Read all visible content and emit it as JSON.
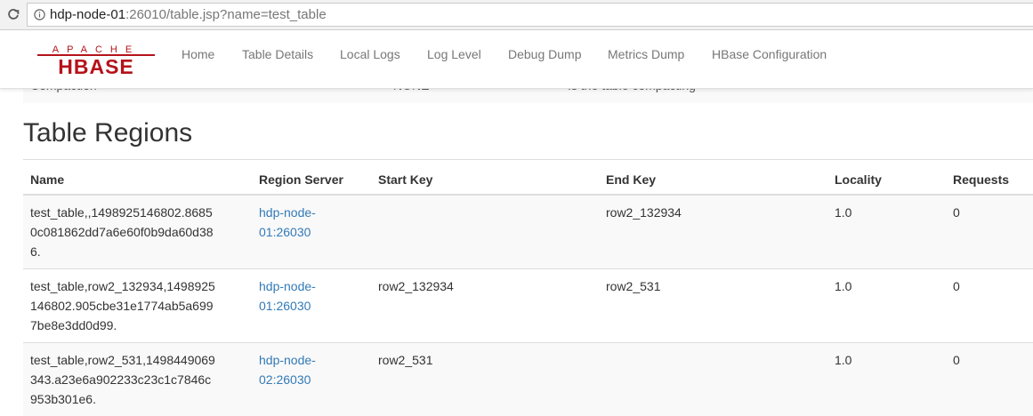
{
  "browser": {
    "url_host": "hdp-node-01",
    "url_rest": ":26010/table.jsp?name=test_table"
  },
  "nav": {
    "logo_top": "APACHE",
    "logo_bottom": "HBASE",
    "items": [
      "Home",
      "Table Details",
      "Local Logs",
      "Log Level",
      "Debug Dump",
      "Metrics Dump",
      "HBase Configuration"
    ]
  },
  "behind_row": {
    "col1": "Compaction",
    "col2": "NONE",
    "col3": "Is the table compacting"
  },
  "section_title": "Table Regions",
  "table": {
    "headers": [
      "Name",
      "Region Server",
      "Start Key",
      "End Key",
      "Locality",
      "Requests"
    ],
    "rows": [
      {
        "name_lines": [
          "test_table,,1498925146802.8685",
          "0c081862dd7a6e60f0b9da60d38",
          "6."
        ],
        "server_lines": [
          "hdp-node-",
          "01:26030"
        ],
        "start_key": "",
        "end_key": "row2_132934",
        "locality": "1.0",
        "requests": "0"
      },
      {
        "name_lines": [
          "test_table,row2_132934,1498925",
          "146802.905cbe31e1774ab5a699",
          "7be8e3dd0d99."
        ],
        "server_lines": [
          "hdp-node-",
          "01:26030"
        ],
        "start_key": "row2_132934",
        "end_key": "row2_531",
        "locality": "1.0",
        "requests": "0"
      },
      {
        "name_lines": [
          "test_table,row2_531,1498449069",
          "343.a23e6a902233c23c1c7846c",
          "953b301e6."
        ],
        "server_lines": [
          "hdp-node-",
          "02:26030"
        ],
        "start_key": "row2_531",
        "end_key": "",
        "locality": "1.0",
        "requests": "0"
      }
    ]
  },
  "colors": {
    "link": "#337ab7",
    "logo_red": "#b5121b",
    "nav_text": "#777777"
  }
}
